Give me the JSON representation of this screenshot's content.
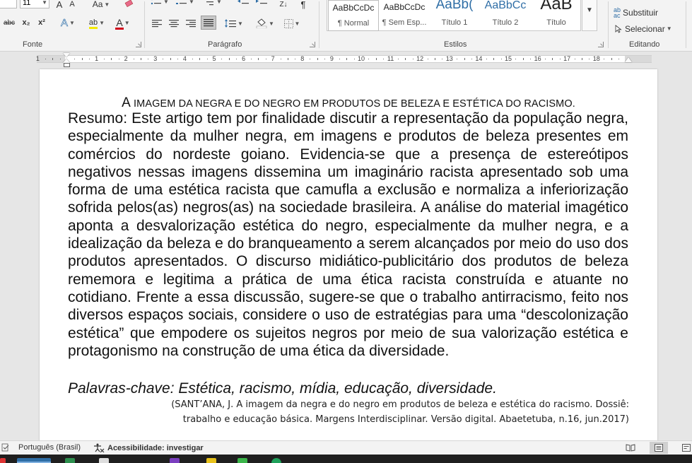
{
  "ribbon": {
    "fonte": {
      "label": "Fonte",
      "font_size": "11",
      "grow_label": "A",
      "shrink_label": "A",
      "case_label": "Aa",
      "strike_label": "abc",
      "subscript_label": "x₂",
      "superscript_label": "x²",
      "effects_label": "A",
      "highlight_label": "ab",
      "font_color_label": "A"
    },
    "paragrafo": {
      "label": "Parágrafo",
      "sort_label": "Z↓",
      "pilcrow": "¶"
    },
    "estilos": {
      "label": "Estilos",
      "tiles": [
        {
          "preview": "AaBbCcDc",
          "name": "¶ Normal",
          "selected": true
        },
        {
          "preview": "AaBbCcDc",
          "name": "¶ Sem Esp...",
          "selected": false
        },
        {
          "preview": "AaBb(",
          "name": "Título 1",
          "selected": false
        },
        {
          "preview": "AaBbCc",
          "name": "Título 2",
          "selected": false
        },
        {
          "preview": "AaB",
          "name": "Título",
          "selected": false
        }
      ]
    },
    "editando": {
      "label": "Editando",
      "replace_label": "Substituir",
      "select_label": "Selecionar"
    }
  },
  "ruler": {
    "numbers": [
      "1",
      "1",
      "2",
      "3",
      "4",
      "5",
      "6",
      "7",
      "8",
      "9",
      "10",
      "11",
      "12",
      "13",
      "14",
      "15",
      "16",
      "17",
      "18"
    ]
  },
  "document": {
    "title_first": "A",
    "title_rest": " IMAGEM DA NEGRA E DO NEGRO EM PRODUTOS DE BELEZA E ESTÉTICA DO RACISMO.",
    "abstract": "Resumo: Este artigo tem por finalidade discutir a representação da população negra, especialmente da mulher negra, em imagens e produtos de beleza presentes em comércios do nordeste goiano. Evidencia-se que a presença de estereótipos negativos nessas imagens dissemina um imaginário racista apresentado sob uma forma de uma estética racista que camufla a exclusão e normaliza a inferiorização sofrida pelos(as) negros(as) na sociedade brasileira. A análise do material imagético aponta a desvalorização estética do negro, especialmente da mulher negra, e a idealização da beleza e do branqueamento a serem alcançados por meio do uso dos produtos apresentados. O discurso midiático-publicitário dos produtos de beleza rememora e legitima a prática de uma ética racista construída e atuante no cotidiano. Frente a essa discussão, sugere-se que o trabalho antirracismo, feito nos diversos espaços sociais, considere o uso de estratégias para uma “descolonização estética” que empodere os sujeitos negros por meio de sua valorização estética e protagonismo na construção de uma ética da diversidade.",
    "keywords": "Palavras-chave: Estética, racismo, mídia, educação, diversidade.",
    "citation_line1": "(SANT’ANA, J. A imagem da negra e do negro em produtos de beleza e estética do racismo. Dossiê:",
    "citation_line2": "trabalho e educação básica. Margens Interdisciplinar. Versão digital. Abaetetuba, n.16, jun.2017)"
  },
  "statusbar": {
    "language": "Português (Brasil)",
    "accessibility": "Acessibilidade: investigar"
  },
  "colors": {
    "font_color_red": "#d0021b",
    "highlight_yellow": "#f5e900",
    "heading_blue": "#2f6ea6"
  }
}
